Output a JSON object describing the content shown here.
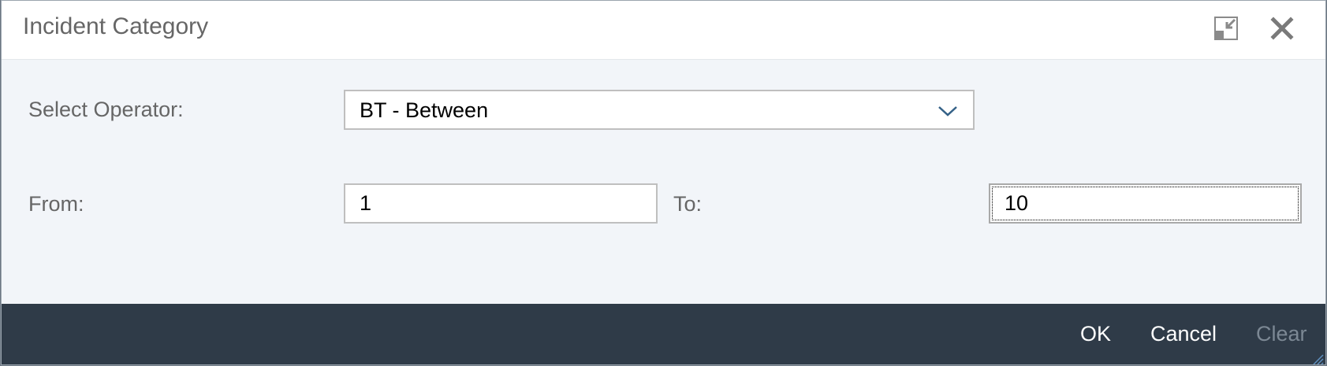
{
  "dialog": {
    "title": "Incident Category",
    "icons": {
      "restore": "restore-down-icon",
      "close": "close-icon"
    }
  },
  "form": {
    "operator_label": "Select Operator:",
    "operator_value": "BT - Between",
    "from_label": "From:",
    "from_value": "1",
    "to_label": "To:",
    "to_value": "10"
  },
  "footer": {
    "ok_label": "OK",
    "cancel_label": "Cancel",
    "clear_label": "Clear"
  },
  "colors": {
    "footer_bg": "#2f3b48",
    "body_bg": "#f2f5f9",
    "label_text": "#666666",
    "disabled_text": "#7c8894",
    "accent": "#346187"
  }
}
